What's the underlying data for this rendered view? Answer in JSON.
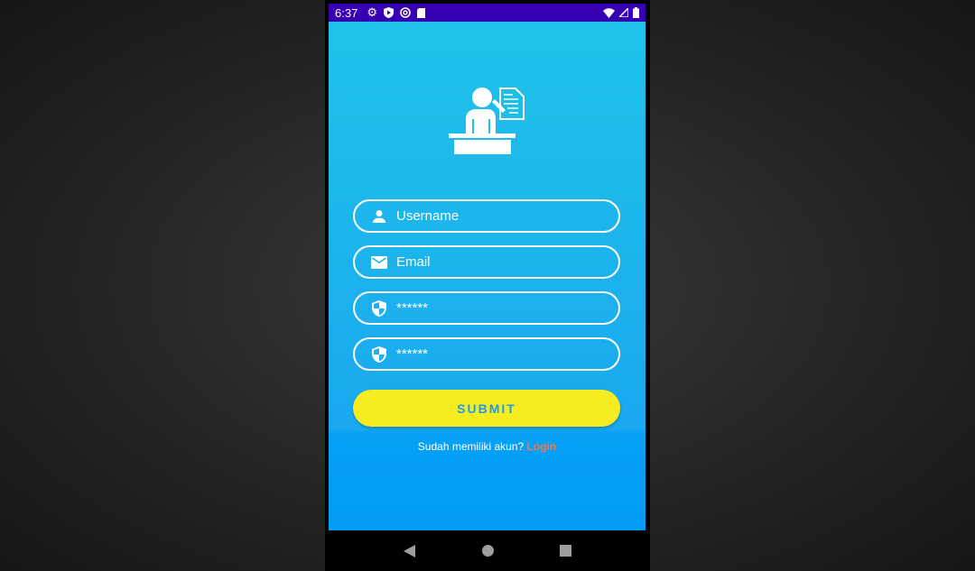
{
  "status_bar": {
    "time": "6:37",
    "icons": [
      "gear-icon",
      "shield-play-icon",
      "sync-icon",
      "sd-card-icon"
    ],
    "right_icons": [
      "wifi-icon",
      "signal-icon",
      "battery-icon"
    ]
  },
  "logo": {
    "icon": "teacher-podium-icon"
  },
  "form": {
    "username": {
      "placeholder": "Username",
      "icon": "person-icon"
    },
    "email": {
      "placeholder": "Email",
      "icon": "mail-icon"
    },
    "password": {
      "value": "******",
      "icon": "shield-icon"
    },
    "confirm_password": {
      "value": "******",
      "icon": "shield-icon"
    },
    "submit_label": "SUBMIT"
  },
  "footer": {
    "text": "Sudah memiliki akun?",
    "link": "Login"
  },
  "colors": {
    "status_bar": "#3700b3",
    "button": "#f7ec1f",
    "link": "#f07a4a",
    "bg_top": "#1fc3e8",
    "bg_bottom": "#039cf6"
  }
}
